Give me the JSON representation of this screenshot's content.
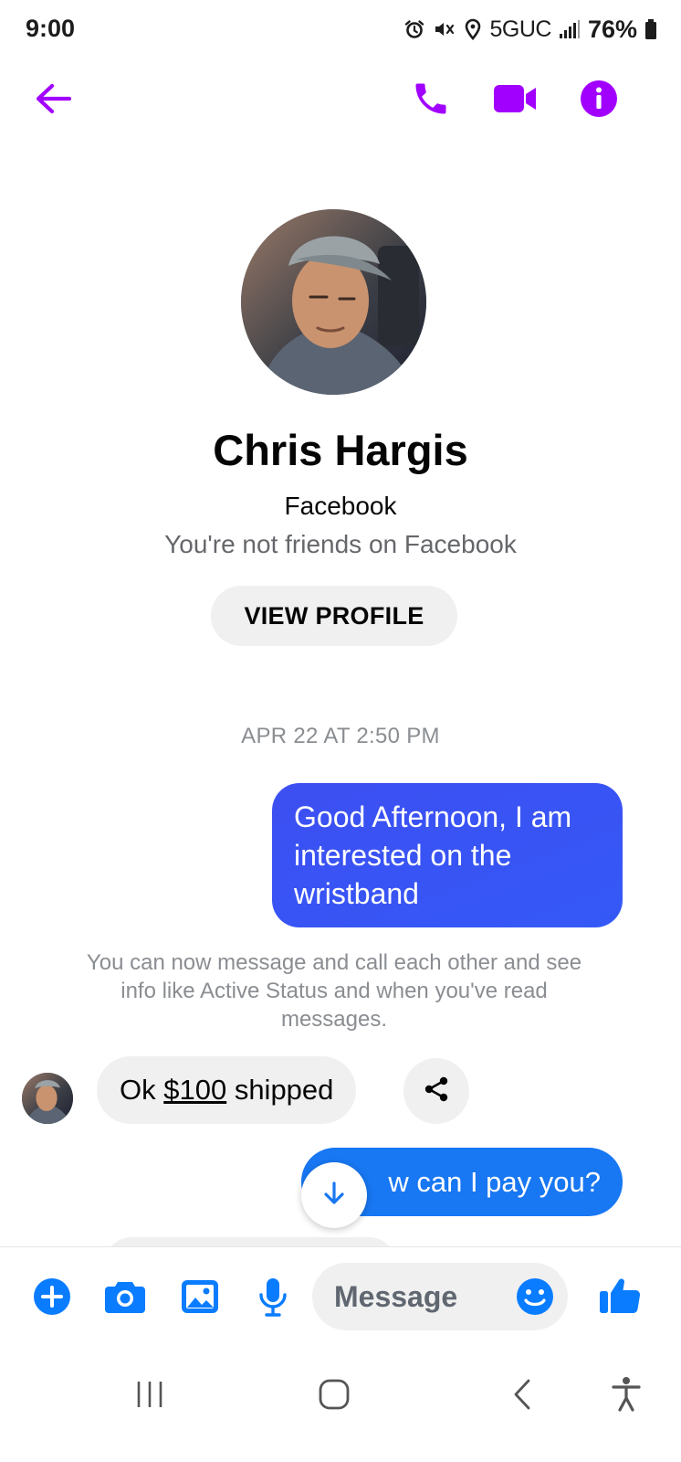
{
  "status_bar": {
    "time": "9:00",
    "network": "5GUC",
    "battery": "76%",
    "icons": [
      "alarm-icon",
      "mute-icon",
      "location-icon",
      "signal-icon",
      "battery-icon"
    ]
  },
  "top_bar": {
    "icons": [
      "back-arrow-icon",
      "phone-icon",
      "video-camera-icon",
      "info-icon"
    ],
    "accent_color": "#a100ff"
  },
  "profile": {
    "name": "Chris Hargis",
    "platform": "Facebook",
    "relation": "You're not friends on Facebook",
    "view_profile_label": "VIEW PROFILE"
  },
  "conversation": {
    "timestamp": "APR 22 AT 2:50 PM",
    "messages": [
      {
        "direction": "outgoing",
        "lines": [
          "Good Afternoon, I am",
          "interested on the",
          "wristband"
        ]
      },
      {
        "direction": "system",
        "text": "You can now message and call each other and see info like Active Status and when you've read messages."
      },
      {
        "direction": "incoming",
        "prefix": "Ok ",
        "price": "$100",
        "suffix": " shipped"
      },
      {
        "direction": "outgoing",
        "text": "w can I pay you?"
      }
    ],
    "outgoing_color": "#1877f2"
  },
  "composer": {
    "placeholder": "Message",
    "icons": [
      "plus-icon",
      "camera-icon",
      "gallery-icon",
      "microphone-icon",
      "emoji-icon",
      "thumbs-up-icon"
    ],
    "accent_color": "#0a7cff"
  },
  "nav_bar": {
    "icons": [
      "recents-icon",
      "home-icon",
      "back-icon",
      "accessibility-icon"
    ]
  }
}
